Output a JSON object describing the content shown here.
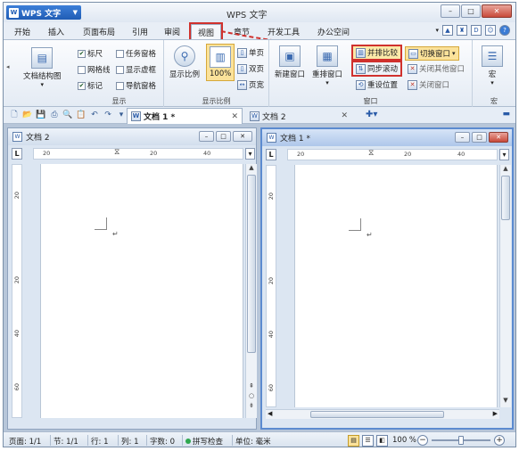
{
  "window": {
    "app_button": "WPS 文字",
    "title": "WPS 文字",
    "minimize": "–",
    "maximize": "□",
    "close": "✕"
  },
  "menu": {
    "tabs": [
      "开始",
      "插入",
      "页面布局",
      "引用",
      "审阅",
      "视图",
      "章节",
      "开发工具",
      "办公空间"
    ],
    "active_tab": "视图"
  },
  "ribbon": {
    "doc_structure": "文档结构图",
    "show_group": {
      "label": "显示",
      "items": [
        {
          "label": "标尺",
          "checked": true
        },
        {
          "label": "任务窗格",
          "checked": false
        },
        {
          "label": "网格线",
          "checked": false
        },
        {
          "label": "显示虚框",
          "checked": false
        },
        {
          "label": "标记",
          "checked": true
        },
        {
          "label": "导航窗格",
          "checked": false
        }
      ]
    },
    "zoom_group": {
      "label": "显示比例",
      "zoom_btn": "显示比例",
      "hundred": "100%",
      "single_page": "单页",
      "two_pages": "双页",
      "page_width": "页宽"
    },
    "window_group": {
      "label": "窗口",
      "new_window": "新建窗口",
      "arrange": "重排窗口",
      "side_by_side": "并排比较",
      "sync_scroll": "同步滚动",
      "reset_position": "重设位置",
      "switch_window": "切换窗口",
      "close_others": "关闭其他窗口",
      "close_window": "关闭窗口"
    },
    "macro_group": {
      "label": "宏",
      "macro": "宏"
    }
  },
  "doc_tabs": [
    {
      "label": "文档 1 *",
      "active": true
    },
    {
      "label": "文档 2",
      "active": false
    }
  ],
  "panes": [
    {
      "title": "文档 2",
      "ruler_labels": [
        "20",
        "20",
        "40"
      ],
      "vruler_labels": [
        "20",
        "20",
        "40",
        "60"
      ]
    },
    {
      "title": "文档 1 *",
      "ruler_labels": [
        "20",
        "20",
        "40"
      ],
      "vruler_labels": [
        "20",
        "20",
        "40",
        "60"
      ]
    }
  ],
  "status": {
    "page": "页面: 1/1",
    "section": "节: 1/1",
    "line": "行: 1",
    "column": "列: 1",
    "words": "字数: 0",
    "spell": "拼写检查",
    "unit": "单位: 毫米",
    "zoom": "100 %",
    "zoom_fraction": 0.5
  }
}
